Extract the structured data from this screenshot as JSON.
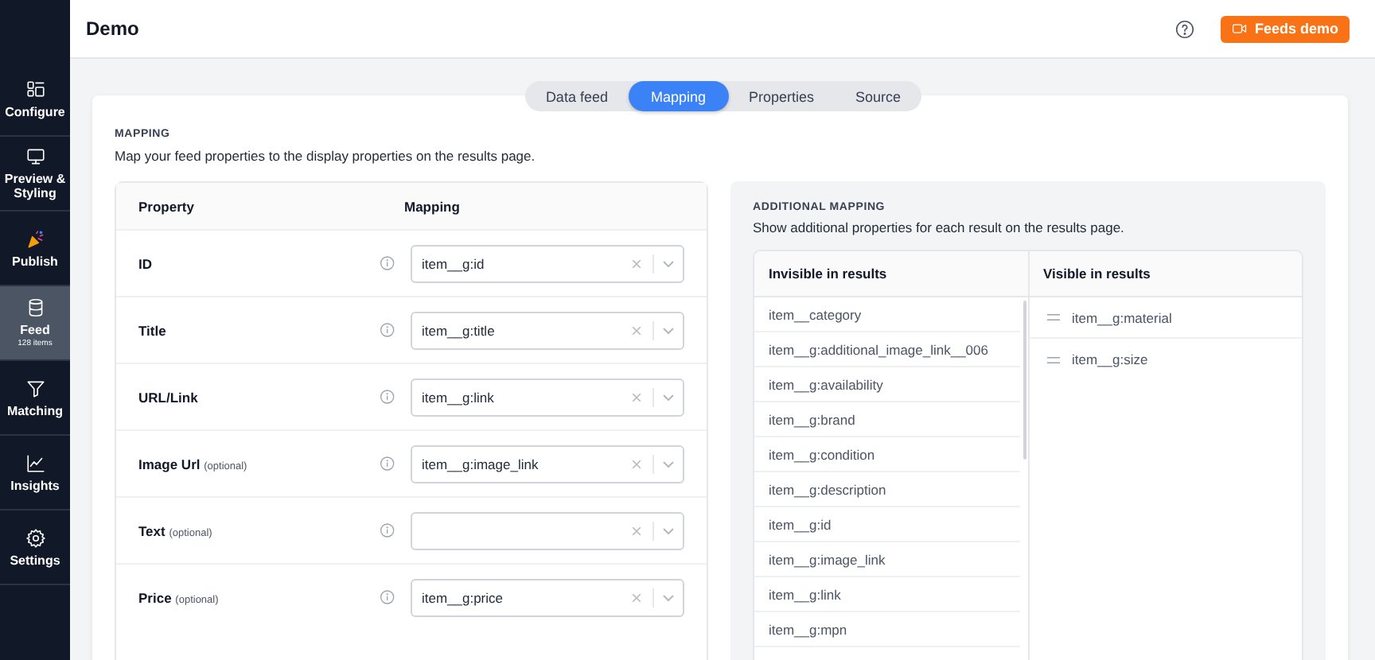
{
  "header": {
    "title": "Demo",
    "demo_button": "Feeds demo"
  },
  "sidebar": {
    "items": [
      {
        "kind": "configure",
        "label": "Configure",
        "selected": false
      },
      {
        "kind": "preview",
        "label": "Preview & Styling",
        "selected": false
      },
      {
        "kind": "publish",
        "label": "Publish",
        "selected": false
      },
      {
        "kind": "feed",
        "label": "Feed",
        "sublabel": "128 items",
        "selected": true
      },
      {
        "kind": "matching",
        "label": "Matching",
        "selected": false
      },
      {
        "kind": "insights",
        "label": "Insights",
        "selected": false
      },
      {
        "kind": "settings",
        "label": "Settings",
        "selected": false
      }
    ]
  },
  "tabs": [
    {
      "label": "Data feed",
      "selected": false
    },
    {
      "label": "Mapping",
      "selected": true
    },
    {
      "label": "Properties",
      "selected": false
    },
    {
      "label": "Source",
      "selected": false
    }
  ],
  "mapping": {
    "heading": "MAPPING",
    "description": "Map your feed properties to the display properties on the results page.",
    "columns": [
      "Property",
      "Mapping"
    ],
    "rows": [
      {
        "label": "ID",
        "value": "item__g:id"
      },
      {
        "label": "Title",
        "value": "item__g:title"
      },
      {
        "label": "URL/Link",
        "value": "item__g:link"
      },
      {
        "label": "Image Url",
        "note": "(optional)",
        "value": "item__g:image_link"
      },
      {
        "label": "Text",
        "note": "(optional)"
      },
      {
        "label": "Price",
        "note": "(optional)",
        "value": "item__g:price"
      }
    ]
  },
  "additional_mapping": {
    "heading": "ADDITIONAL MAPPING",
    "description": "Show additional properties for each result on the results page.",
    "columns": [
      "Invisible in results",
      "Visible in results"
    ],
    "invisible": [
      "item__category",
      "item__g:additional_image_link__006",
      "item__g:availability",
      "item__g:brand",
      "item__g:condition",
      "item__g:description",
      "item__g:id",
      "item__g:image_link",
      "item__g:link",
      "item__g:mpn"
    ],
    "visible": [
      "item__g:material",
      "item__g:size"
    ]
  }
}
